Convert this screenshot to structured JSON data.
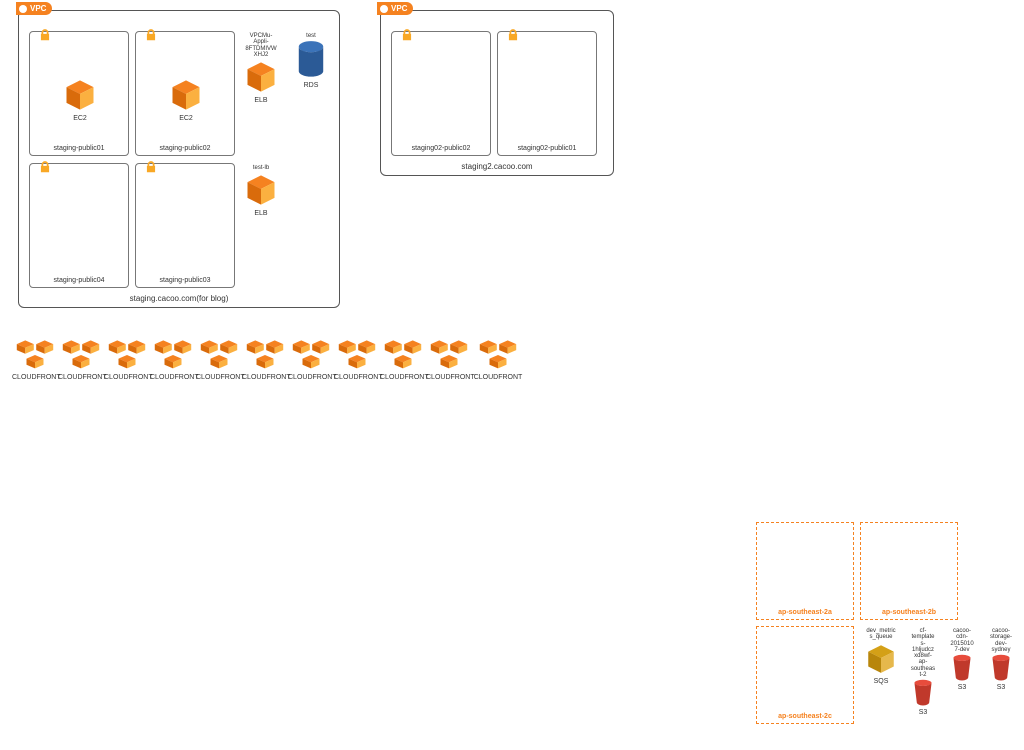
{
  "vpc_badge": "VPC",
  "vpc1": {
    "label": "staging.cacoo.com(for blog)",
    "subnets": [
      {
        "label": "staging-public01"
      },
      {
        "label": "staging-public02"
      },
      {
        "label": "staging-public04"
      },
      {
        "label": "staging-public03"
      }
    ],
    "ec2_label": "EC2",
    "elb1_top": "VPCMu-\nAppli-\n8FTDMIVW\nXHJ2",
    "elb_label": "ELB",
    "rds_top": "test",
    "rds_label": "RDS",
    "elb2_top": "test-lb"
  },
  "vpc2": {
    "label": "staging2.cacoo.com",
    "subnets": [
      {
        "label": "staging02-public02"
      },
      {
        "label": "staging02-public01"
      }
    ]
  },
  "cloudfront_label": "CLOUDFRONT",
  "cloudfront_count": 11,
  "az": {
    "a": "ap-southeast-2a",
    "b": "ap-southeast-2b",
    "c": "ap-southeast-2c"
  },
  "sqs": {
    "top": "dev_metric\ns_queue",
    "label": "SQS"
  },
  "s3_1": {
    "top": "cf-\ntemplate\ns-\n1hljudcz\nxd8wf-\nap-\nsoutheas\nt-2",
    "label": "S3"
  },
  "s3_2": {
    "top": "cacoo-\ncdn-\n2015010\n7-dev",
    "label": "S3"
  },
  "s3_3": {
    "top": "cacoo-\nstorage-\ndev-\nsydney",
    "label": "S3"
  }
}
